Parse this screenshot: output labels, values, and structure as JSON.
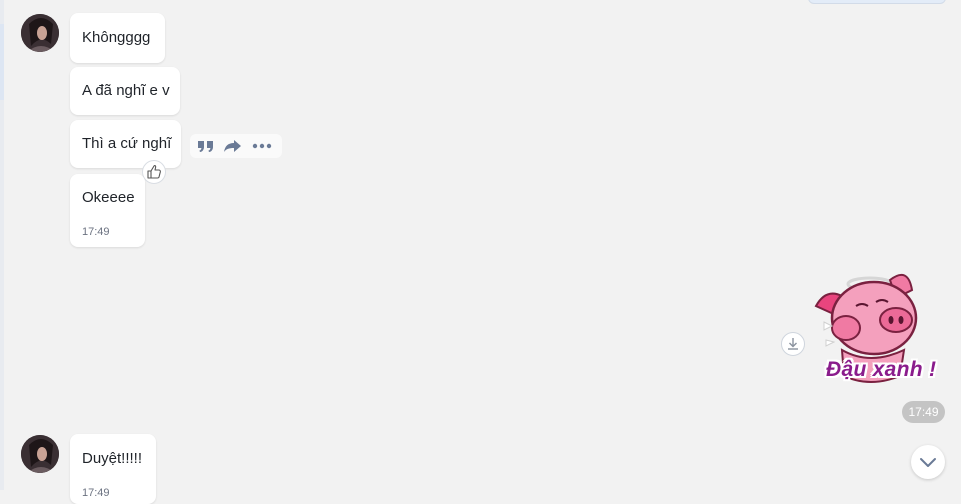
{
  "messages": [
    {
      "text": "Khôngggg"
    },
    {
      "text": "A đã nghĩ e v"
    },
    {
      "text": "Thì a cứ nghĩ"
    },
    {
      "text": "Okeeee",
      "time": "17:49"
    },
    {
      "text": "Duyệt!!!!!",
      "time": "17:49"
    }
  ],
  "sticker": {
    "caption": "Đậu xanh !",
    "time": "17:49"
  },
  "icons": {
    "quote": "quote-icon",
    "forward": "forward-icon",
    "more": "more-icon",
    "reaction": "thumbs-up-icon",
    "download": "download-icon",
    "scroll": "chevron-down-icon"
  },
  "colors": {
    "background": "#f2f2f2",
    "bubble": "#ffffff",
    "action_icon": "#6a7a96",
    "sticker_caption": "#8a1c8c",
    "time_pill": "#c4c4c4"
  }
}
